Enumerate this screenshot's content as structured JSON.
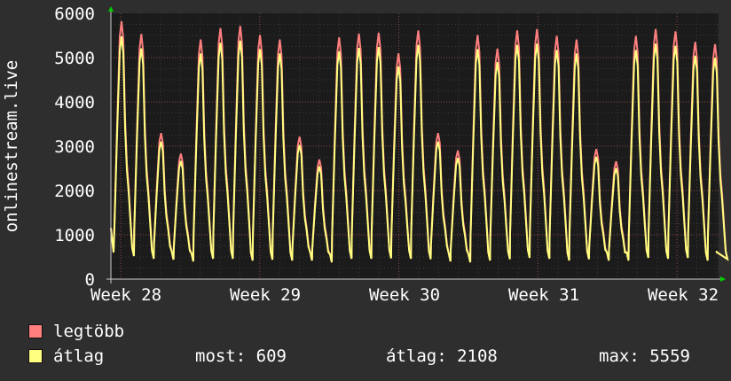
{
  "chart_data": {
    "type": "line",
    "ylabel": "onlinestream.live",
    "y_ticks": [
      "0",
      "1000",
      "2000",
      "3000",
      "4000",
      "5000",
      "6000"
    ],
    "ylim": [
      0,
      6000
    ],
    "x_ticks": [
      "Week 28",
      "Week 29",
      "Week 30",
      "Week 31",
      "Week 32"
    ],
    "grid": true,
    "daily_peaks": [
      5650,
      5370,
      3200,
      2750,
      5250,
      5500,
      5550,
      5350,
      5250,
      3120,
      2620,
      5300,
      5380,
      5400,
      4950,
      5450,
      3200,
      2820,
      5350,
      5050,
      5450,
      5480,
      5330,
      5250,
      2850,
      2580,
      5330,
      5480,
      5430,
      5200,
      5150
    ],
    "daily_troughs": [
      520,
      460,
      440,
      400,
      460,
      460,
      420,
      440,
      420,
      420,
      380,
      460,
      460,
      470,
      460,
      450,
      400,
      380,
      420,
      450,
      480,
      460,
      420,
      450,
      420,
      420,
      480,
      460,
      480,
      420,
      450
    ],
    "end_value": 609,
    "series": [
      {
        "name": "legtöbb",
        "color": "#ff7f7f"
      },
      {
        "name": "átlag",
        "color": "#ffff80"
      }
    ]
  },
  "legend": {
    "max_label": "legtöbb",
    "avg_label": "átlag"
  },
  "stats": {
    "now": "most: 609",
    "avg": "átlag: 2108",
    "max": "max: 5559"
  }
}
